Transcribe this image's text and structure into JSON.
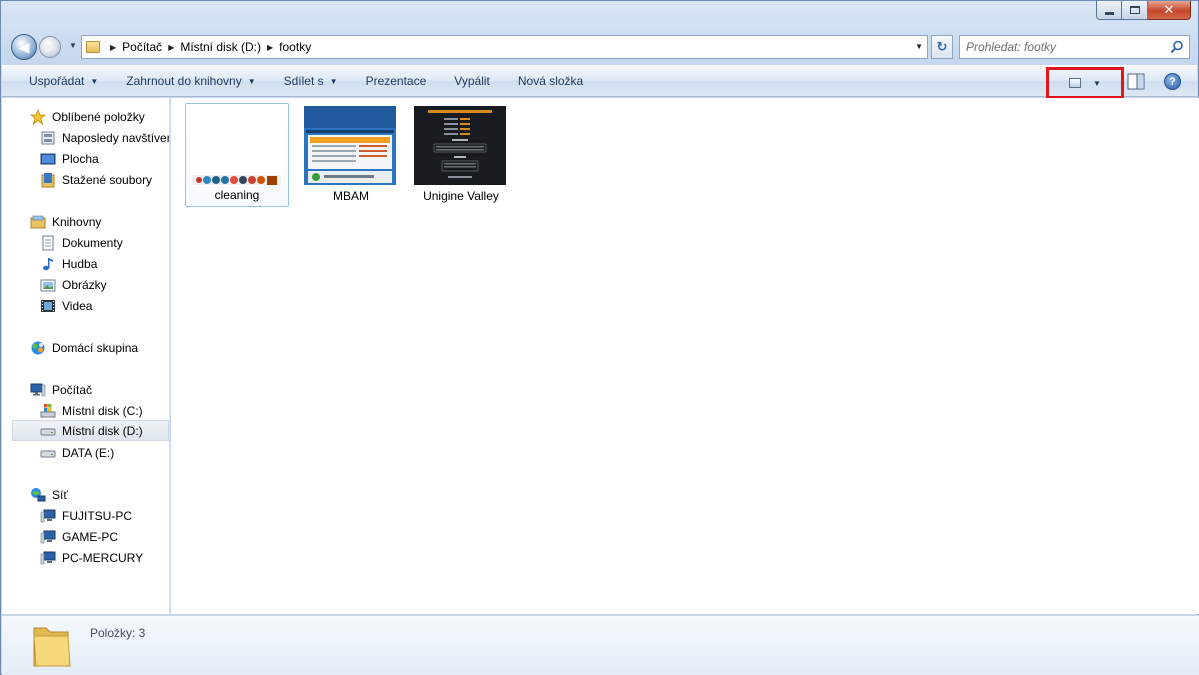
{
  "window": {
    "controls": {
      "minimize": "minimize",
      "maximize": "maximize",
      "close": "close"
    }
  },
  "address_bar": {
    "crumbs": [
      "Počítač",
      "Místní disk (D:)",
      "footky"
    ]
  },
  "search": {
    "placeholder": "Prohledat: footky"
  },
  "command_bar": {
    "organize": "Uspořádat",
    "include_library": "Zahrnout do knihovny",
    "share": "Sdílet s",
    "slideshow": "Prezentace",
    "burn": "Vypálit",
    "new_folder": "Nová složka"
  },
  "sidebar": {
    "favorites": {
      "label": "Oblíbené položky",
      "items": [
        "Naposledy navštívené",
        "Plocha",
        "Stažené soubory"
      ]
    },
    "libraries": {
      "label": "Knihovny",
      "items": [
        "Dokumenty",
        "Hudba",
        "Obrázky",
        "Videa"
      ]
    },
    "homegroup": {
      "label": "Domácí skupina"
    },
    "computer": {
      "label": "Počítač",
      "items": [
        "Místní disk (C:)",
        "Místní disk (D:)",
        "DATA (E:)"
      ]
    },
    "network": {
      "label": "Síť",
      "items": [
        "FUJITSU-PC",
        "GAME-PC",
        "PC-MERCURY"
      ]
    }
  },
  "files": [
    {
      "name": "cleaning",
      "selected": true
    },
    {
      "name": "MBAM",
      "selected": false
    },
    {
      "name": "Unigine Valley",
      "selected": false
    }
  ],
  "status": {
    "items_count": "Položky: 3"
  },
  "colors": {
    "highlight_border": "#e0161f",
    "selection": "#99c3e9"
  }
}
